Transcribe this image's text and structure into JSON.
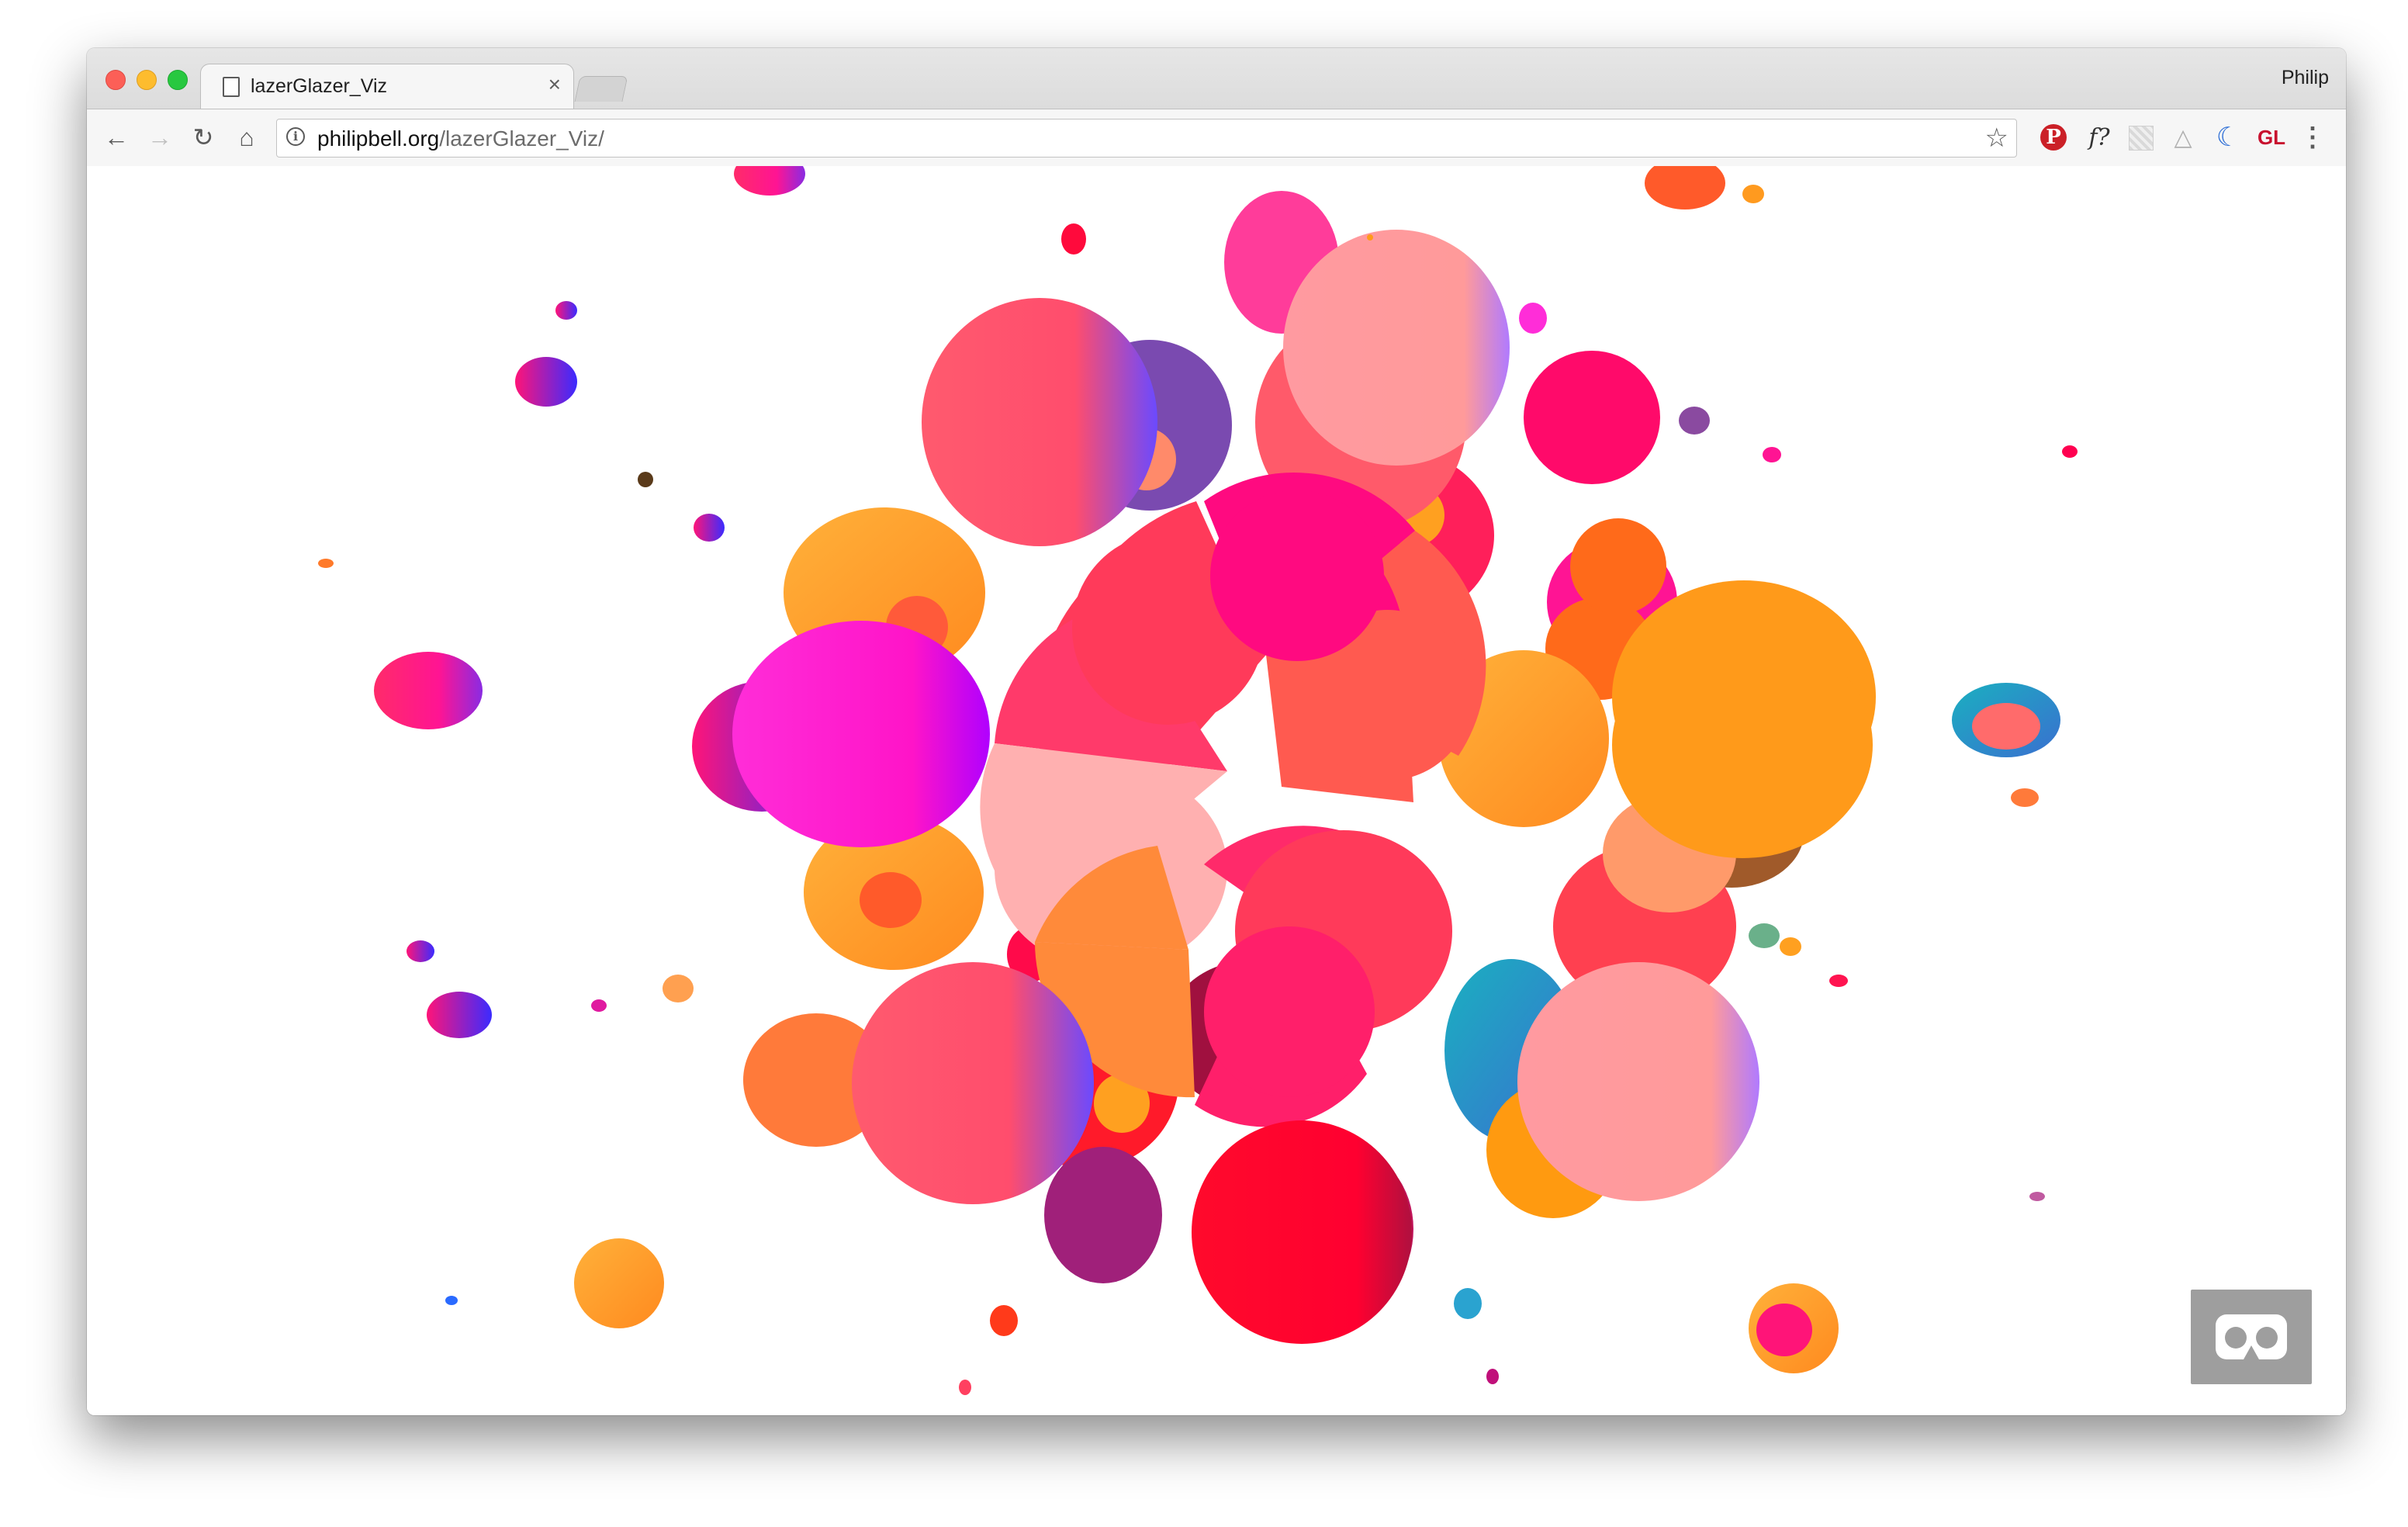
{
  "browser": {
    "tab_title": "lazerGlazer_Viz",
    "tab_close_glyph": "×",
    "profile_name": "Philip",
    "url_host": "philipbell.org",
    "url_path": "/lazerGlazer_Viz/",
    "nav_icons": [
      "back-arrow-icon",
      "forward-arrow-icon",
      "reload-icon",
      "home-icon"
    ],
    "extension_icons": [
      "pinterest-icon",
      "fontface-ninja-icon",
      "grid-extension-icon",
      "google-drive-icon",
      "moon-extension-icon",
      "gl-extension-icon",
      "menu-icon"
    ],
    "glyphs": {
      "back": "←",
      "forward": "→",
      "reload": "↻",
      "home": "⌂",
      "info": "i",
      "star": "☆",
      "pinterest": "P",
      "fontface": "f?",
      "drive": "△",
      "moon": "☾",
      "gl": "GL",
      "menu": "⋮"
    }
  },
  "scene": {
    "background": "#ffffff",
    "palette": [
      "#ff4d6d",
      "#ff1493",
      "#ff9a1f",
      "#ff6b6b",
      "#ffa9a9",
      "#6b4aff",
      "#ff3366",
      "#ff0030",
      "#1aa3a3"
    ],
    "vr_button_icon": "vr-headset-icon"
  }
}
